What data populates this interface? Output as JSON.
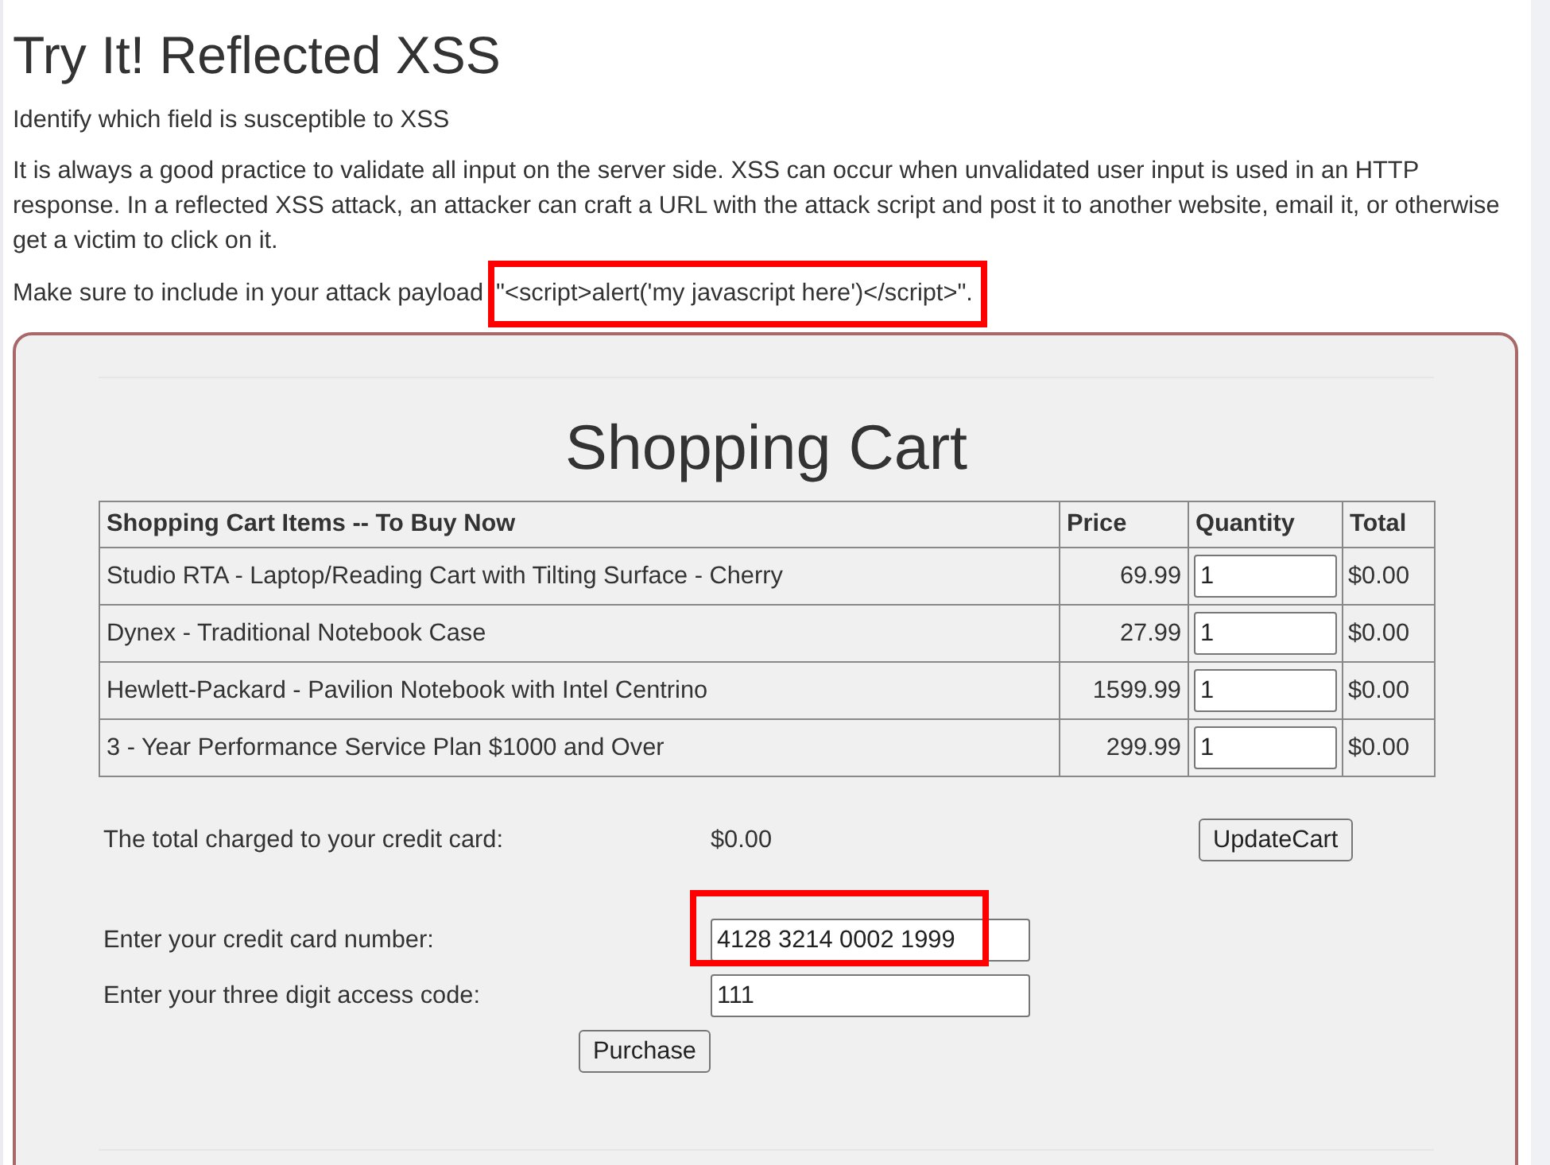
{
  "intro": {
    "title": "Try It! Reflected XSS",
    "subtitle": "Identify which field is susceptible to XSS",
    "description": "It is always a good practice to validate all input on the server side. XSS can occur when unvalidated user input is used in an HTTP response. In a reflected XSS attack, an attacker can craft a URL with the attack script and post it to another website, email it, or otherwise get a victim to click on it.",
    "instruction": {
      "text": "Make sure to include in your attack payload",
      "payload": "\"<script>alert('my javascript here')</script>\".",
      "highlighted": true
    }
  },
  "cart": {
    "title": "Shopping Cart",
    "columns": [
      "Shopping Cart Items -- To Buy Now",
      "Price",
      "Quantity",
      "Total"
    ],
    "rows": [
      {
        "item": "Studio RTA - Laptop/Reading Cart with Tilting Surface - Cherry",
        "price": "69.99",
        "quantity": "1",
        "total": "$0.00"
      },
      {
        "item": "Dynex - Traditional Notebook Case",
        "price": "27.99",
        "quantity": "1",
        "total": "$0.00"
      },
      {
        "item": "Hewlett-Packard - Pavilion Notebook with Intel Centrino",
        "price": "1599.99",
        "quantity": "1",
        "total": "$0.00"
      },
      {
        "item": "3 - Year Performance Service Plan $1000 and Over",
        "price": "299.99",
        "quantity": "1",
        "total": "$0.00"
      }
    ],
    "total_label": "The total charged to your credit card:",
    "total_value": "$0.00",
    "update_button": "UpdateCart"
  },
  "payment": {
    "fields": [
      {
        "label": "Enter your credit card number:",
        "value": "4128 3214 0002 1999",
        "highlighted": true
      },
      {
        "label": "Enter your three digit access code:",
        "value": "111",
        "highlighted": false
      }
    ],
    "purchase_button": "Purchase"
  }
}
